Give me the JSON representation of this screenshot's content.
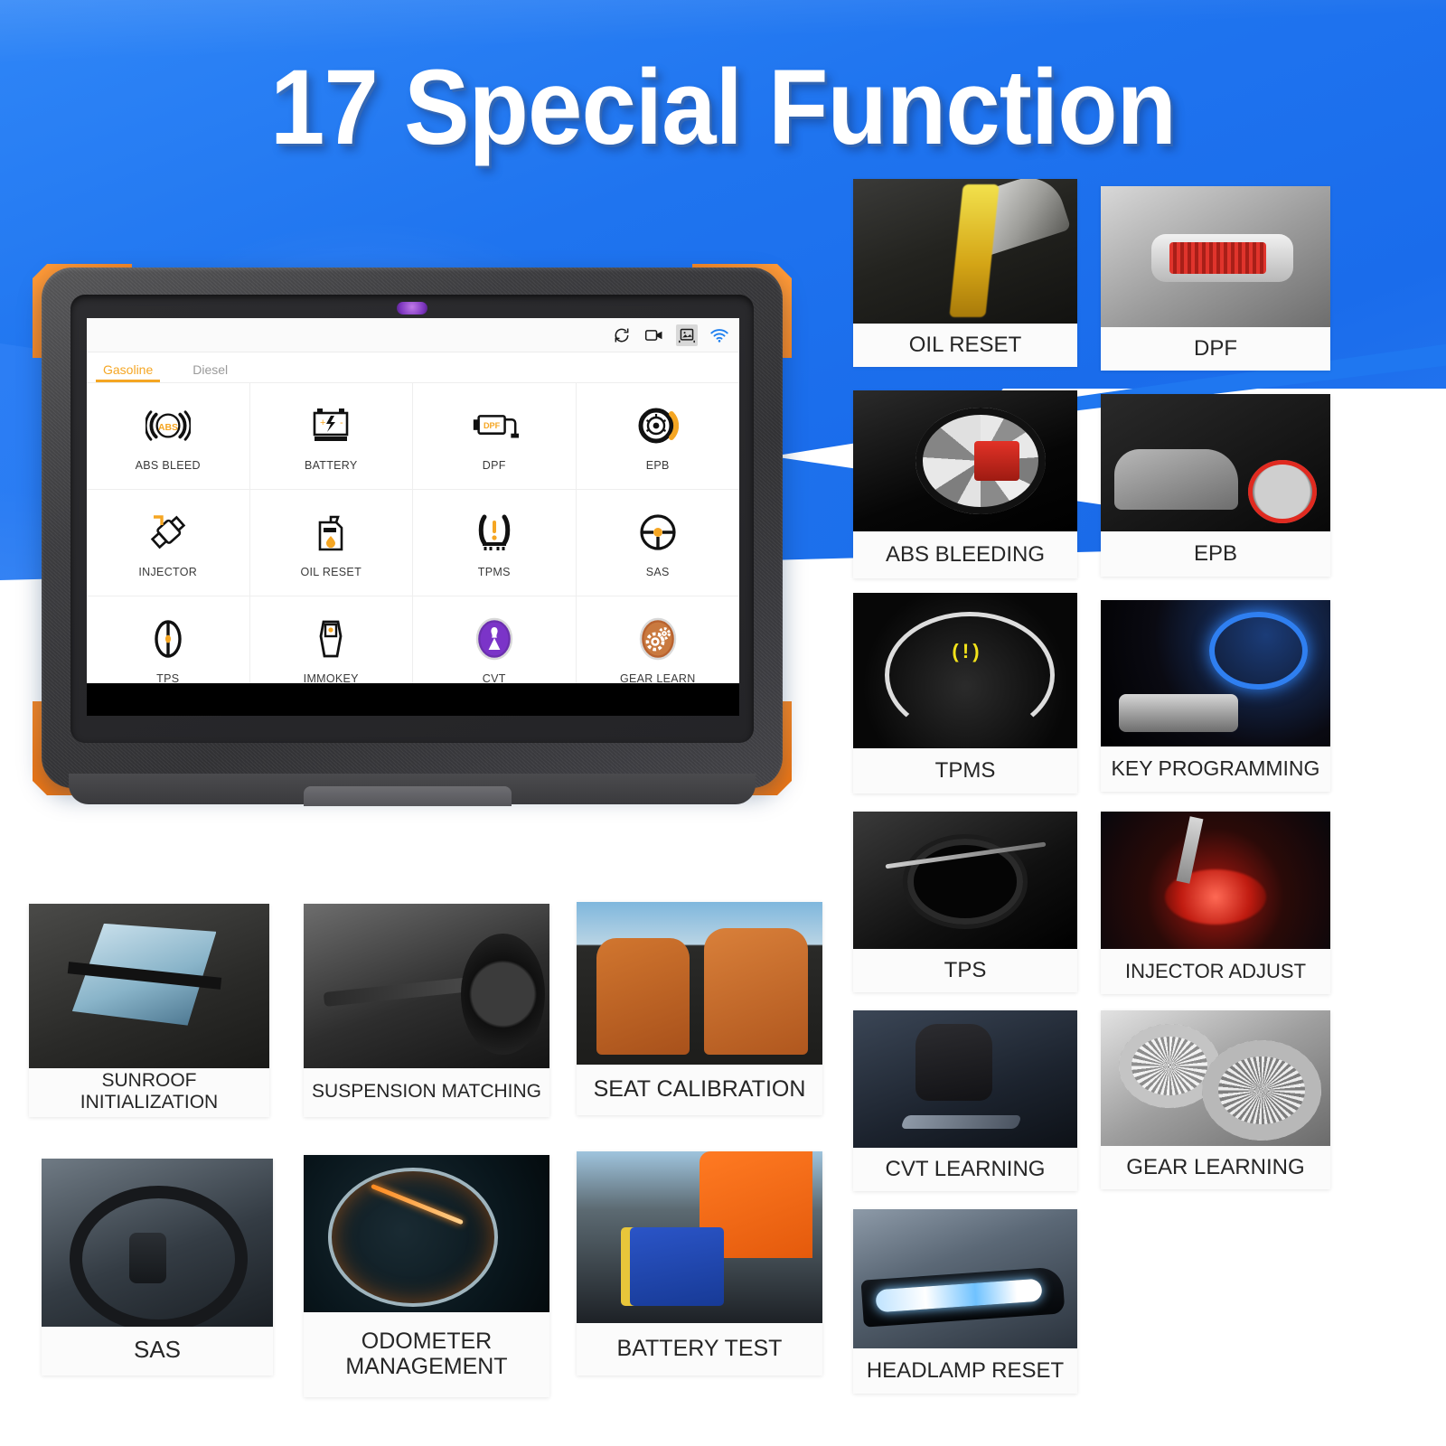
{
  "page": {
    "title": "17 Special Function",
    "accent_blue": "#1f74ef",
    "accent_orange": "#f58220",
    "card_label_color": "#262626"
  },
  "tablet": {
    "statusbar": {
      "icons": [
        "refresh-icon",
        "video-record-icon",
        "screenshot-icon",
        "wifi-icon"
      ]
    },
    "tabs": [
      {
        "label": "Gasoline",
        "active": true
      },
      {
        "label": "Diesel",
        "active": false
      }
    ],
    "grid": [
      {
        "label": "ABS BLEED",
        "icon": "abs-icon"
      },
      {
        "label": "BATTERY",
        "icon": "battery-icon"
      },
      {
        "label": "DPF",
        "icon": "dpf-filter-icon"
      },
      {
        "label": "EPB",
        "icon": "epb-brake-icon"
      },
      {
        "label": "INJECTOR",
        "icon": "injector-icon"
      },
      {
        "label": "OIL RESET",
        "icon": "oil-can-icon"
      },
      {
        "label": "TPMS",
        "icon": "tire-pressure-icon"
      },
      {
        "label": "SAS",
        "icon": "steering-wheel-icon"
      },
      {
        "label": "TPS",
        "icon": "throttle-position-icon"
      },
      {
        "label": "IMMOKEY",
        "icon": "immobilizer-key-icon"
      },
      {
        "label": "CVT",
        "icon": "cvt-icon"
      },
      {
        "label": "GEAR LEARN",
        "icon": "gear-learn-icon"
      }
    ]
  },
  "cards_right": [
    {
      "label": "OIL RESET",
      "art": "art-oil"
    },
    {
      "label": "DPF",
      "art": "art-dpf"
    },
    {
      "label": "ABS BLEEDING",
      "art": "art-abs"
    },
    {
      "label": "EPB",
      "art": "art-epb"
    },
    {
      "label": "TPMS",
      "art": "art-tpms"
    },
    {
      "label": "KEY PROGRAMMING",
      "art": "art-key"
    },
    {
      "label": "TPS",
      "art": "art-tps"
    },
    {
      "label": "INJECTOR ADJUST",
      "art": "art-inj"
    },
    {
      "label": "CVT LEARNING",
      "art": "art-cvt"
    },
    {
      "label": "GEAR LEARNING",
      "art": "art-gear"
    },
    {
      "label": "HEADLAMP RESET",
      "art": "art-head"
    }
  ],
  "cards_bottom": [
    {
      "label": "SUNROOF INITIALIZATION",
      "art": "art-sunroof"
    },
    {
      "label": "SUSPENSION MATCHING",
      "art": "art-susp"
    },
    {
      "label": "SEAT CALIBRATION",
      "art": "art-seat"
    },
    {
      "label": "SAS",
      "art": "art-sas"
    },
    {
      "label": "ODOMETER MANAGEMENT",
      "art": "art-odo"
    },
    {
      "label": "BATTERY TEST",
      "art": "art-batt"
    }
  ]
}
